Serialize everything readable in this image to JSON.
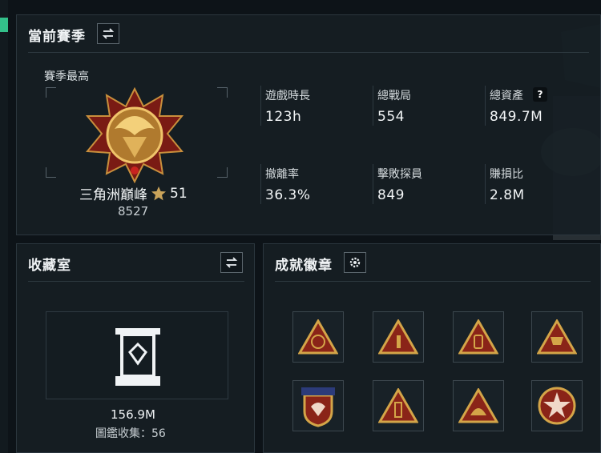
{
  "season": {
    "title": "當前賽季",
    "best_label": "賽季最高",
    "rank_name": "三角洲巔峰",
    "rank_stars": "51",
    "rank_points": "8527",
    "stats": [
      {
        "label": "遊戲時長",
        "value": "123h"
      },
      {
        "label": "總戰局",
        "value": "554"
      },
      {
        "label": "總資產",
        "value": "849.7M"
      },
      {
        "label": "撤離率",
        "value": "36.3%"
      },
      {
        "label": "擊敗探員",
        "value": "849"
      },
      {
        "label": "賺損比",
        "value": "2.8M"
      }
    ],
    "help_mark": "?"
  },
  "collection": {
    "title": "收藏室",
    "value": "156.9M",
    "catalog": "圖鑑收集：56"
  },
  "achievements": {
    "title": "成就徽章",
    "badges": [
      {
        "icon": "radar-dish-badge-icon"
      },
      {
        "icon": "number-one-badge-icon"
      },
      {
        "icon": "bottle-badge-icon"
      },
      {
        "icon": "trophy-badge-icon"
      },
      {
        "icon": "eagle-shield-badge-icon"
      },
      {
        "icon": "usb-drive-badge-icon"
      },
      {
        "icon": "helmet-badge-icon"
      },
      {
        "icon": "star-emblem-badge-icon"
      }
    ]
  },
  "colors": {
    "accent_gold": "#d4a548",
    "badge_red": "#8a2418",
    "panel_bg": "#161e24"
  }
}
